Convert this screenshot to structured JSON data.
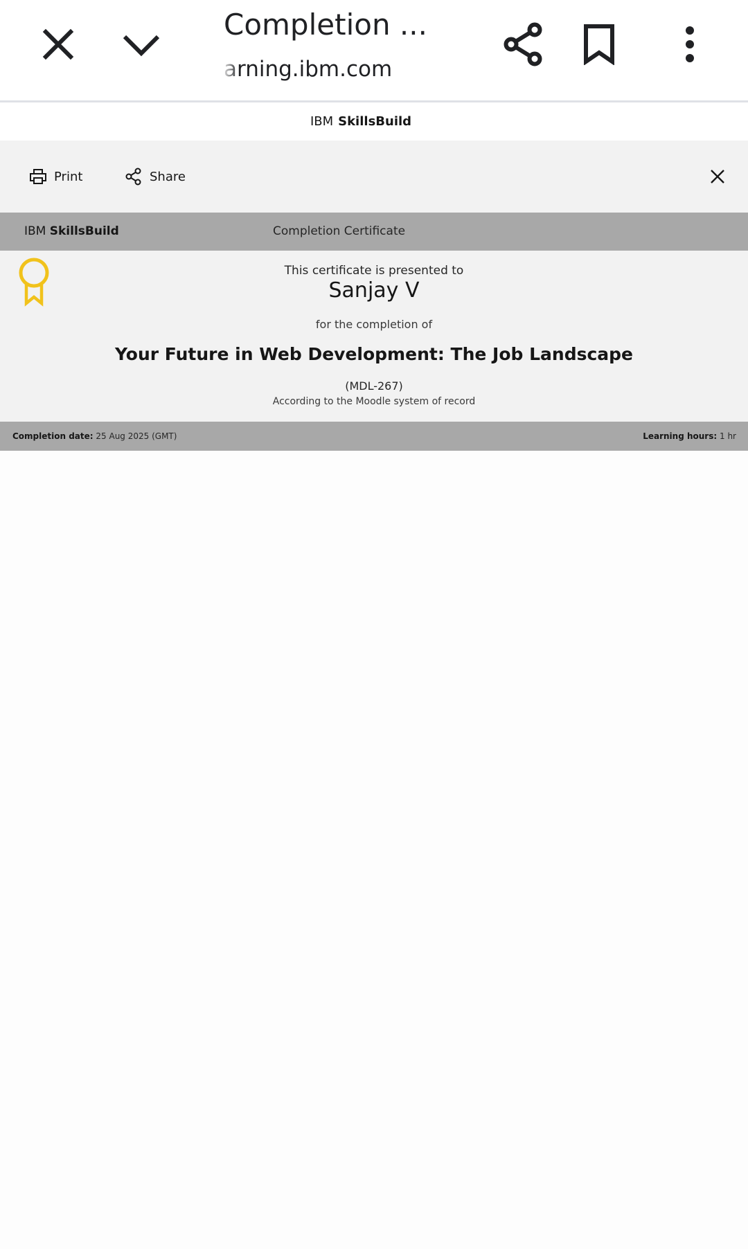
{
  "browser": {
    "title": "Completion ...",
    "url": "arning.ibm.com",
    "icons": {
      "close": "close-icon",
      "minimize": "chevron-down-icon",
      "share": "share-icon",
      "bookmark": "bookmark-icon",
      "menu": "more-vert-icon"
    }
  },
  "site_header": {
    "brand_ibm": "IBM",
    "brand_product": "SkillsBuild"
  },
  "actions": {
    "print_label": "Print",
    "share_label": "Share",
    "close_icon": "close-icon"
  },
  "certificate": {
    "brand_ibm": "IBM",
    "brand_product": "SkillsBuild",
    "type": "Completion Certificate",
    "presented_to": "This certificate is presented to",
    "recipient": "Sanjay V",
    "for_completion": "for the completion of",
    "course_title": "Your Future in Web Development: The Job Landscape",
    "course_code": "(MDL-267)",
    "record_source": "According to the Moodle system of record",
    "completion_date_label": "Completion date:",
    "completion_date_value": "25 Aug 2025 (GMT)",
    "learning_hours_label": "Learning hours:",
    "learning_hours_value": "1 hr"
  },
  "colors": {
    "ribbon": "#f1c21b",
    "cert_band": "#a8a8a8",
    "cert_body": "#f2f2f2",
    "action_bar": "#f2f2f2"
  }
}
